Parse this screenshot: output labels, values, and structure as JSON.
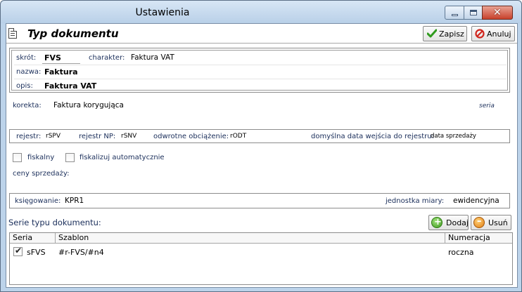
{
  "window": {
    "title": "Ustawienia",
    "controls": {
      "minimize": "minimize",
      "maximize": "maximize",
      "close": "✕"
    }
  },
  "header": {
    "title": "Typ dokumentu",
    "save_label": "Zapisz",
    "cancel_label": "Anuluj"
  },
  "basic": {
    "skrot_label": "skrót:",
    "skrot_value": "FVS",
    "charakter_label": "charakter:",
    "charakter_value": "Faktura VAT",
    "nazwa_label": "nazwa:",
    "nazwa_value": "Faktura",
    "opis_label": "opis:",
    "opis_value": "Faktura VAT"
  },
  "korekta": {
    "label": "korekta:",
    "value": "Faktura korygująca",
    "seria": "seria"
  },
  "register": {
    "rejestr_label": "rejestr:",
    "rejestr_value": "rSPV",
    "rejestr_np_label": "rejestr NP:",
    "rejestr_np_value": "rSNV",
    "odwrotne_label": "odwrotne obciążenie:",
    "odwrotne_value": "rODT",
    "data_label": "domyślna data wejścia do rejestru:",
    "data_value": "data sprzedaży"
  },
  "options": {
    "fiskalny_label": "fiskalny",
    "fiskalny_checked": false,
    "fiskalizuj_label": "fiskalizuj automatycznie",
    "fiskalizuj_checked": false,
    "ceny_label": "ceny sprzedaży:"
  },
  "accounting": {
    "ksiegowanie_label": "księgowanie:",
    "ksiegowanie_value": "KPR1",
    "jednostka_label": "jednostka miary:",
    "jednostka_value": "ewidencyjna"
  },
  "series": {
    "title": "Serie typu dokumentu:",
    "add_label": "Dodaj",
    "remove_label": "Usuń",
    "columns": [
      "Seria",
      "Szablon",
      "Numeracja"
    ],
    "rows": [
      {
        "checked": true,
        "seria": "sFVS",
        "szablon": "#r-FVS/#n4",
        "numeracja": "roczna"
      }
    ]
  }
}
